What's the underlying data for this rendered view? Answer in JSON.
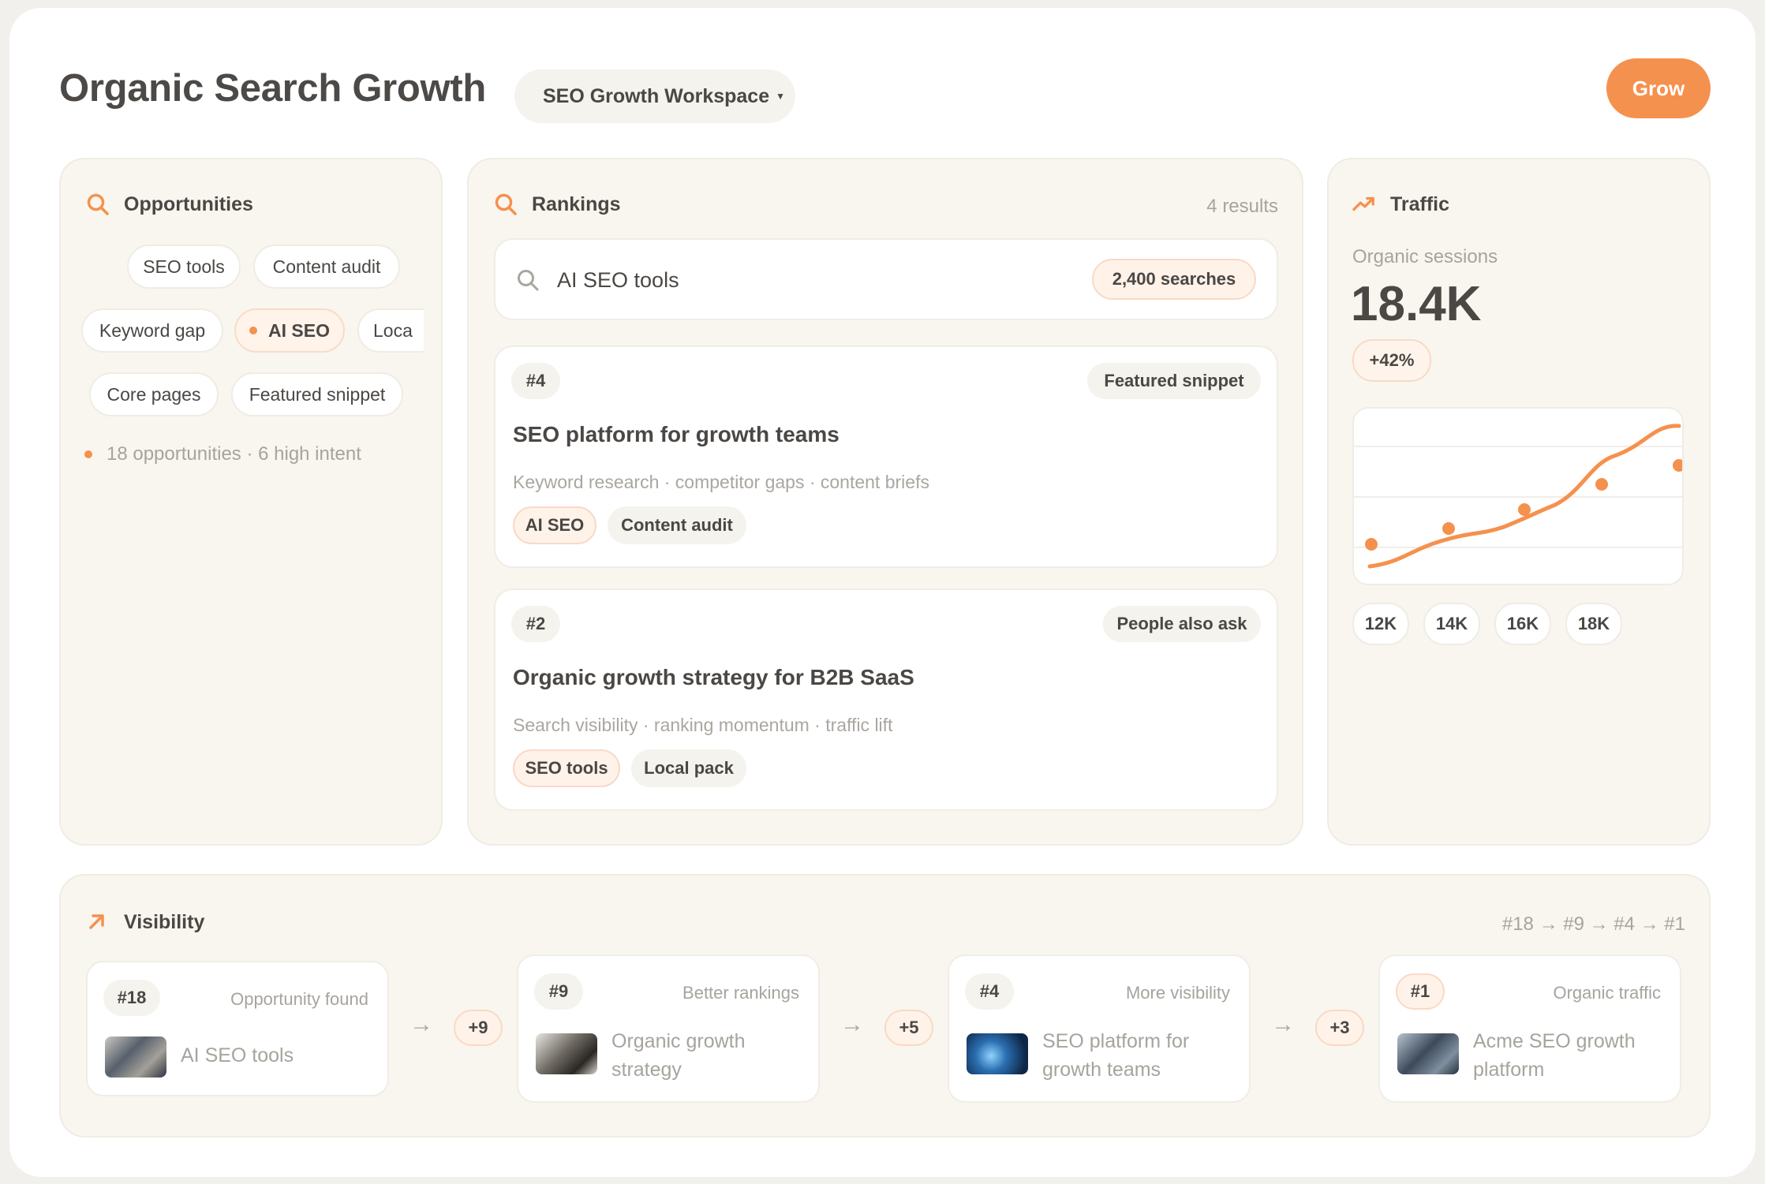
{
  "header": {
    "title": "Organic Search Growth",
    "workspace": "SEO Growth Workspace",
    "grow_label": "Grow"
  },
  "opportunities": {
    "title": "Opportunities",
    "chips": [
      "SEO tools",
      "Content audit",
      "Keyword gap",
      "AI SEO",
      "Loca",
      "Core pages",
      "Featured snippet"
    ],
    "active_chip": "AI SEO",
    "summary": "18 opportunities · 6 high intent"
  },
  "rankings": {
    "title": "Rankings",
    "count": "4 results",
    "search_value": "AI SEO tools",
    "search_volume": "2,400 searches",
    "results": [
      {
        "rank": "#4",
        "feature": "Featured snippet",
        "title": "SEO platform for growth teams",
        "subtitle": "Keyword research · competitor gaps · content briefs",
        "tags": [
          "AI SEO",
          "Content audit"
        ]
      },
      {
        "rank": "#2",
        "feature": "People also ask",
        "title": "Organic growth strategy for B2B SaaS",
        "subtitle": "Search visibility · ranking momentum · traffic lift",
        "tags": [
          "SEO tools",
          "Local pack"
        ]
      }
    ]
  },
  "traffic": {
    "title": "Traffic",
    "metric_label": "Organic sessions",
    "metric_value": "18.4K",
    "change": "+42%",
    "ticks": [
      "12K",
      "14K",
      "16K",
      "18K"
    ],
    "accent": "#f5914e"
  },
  "visibility": {
    "title": "Visibility",
    "path": "#18 → #9 → #4 → #1",
    "steps": [
      {
        "rank": "#18",
        "stage": "Opportunity found",
        "label": "AI SEO tools"
      },
      {
        "rank": "#9",
        "stage": "Better rankings",
        "label": "Organic growth strategy"
      },
      {
        "rank": "#4",
        "stage": "More visibility",
        "label": "SEO platform for growth teams"
      },
      {
        "rank": "#1",
        "stage": "Organic traffic",
        "label": "Acme SEO growth platform"
      }
    ],
    "deltas": [
      "+9",
      "+5",
      "+3"
    ]
  }
}
